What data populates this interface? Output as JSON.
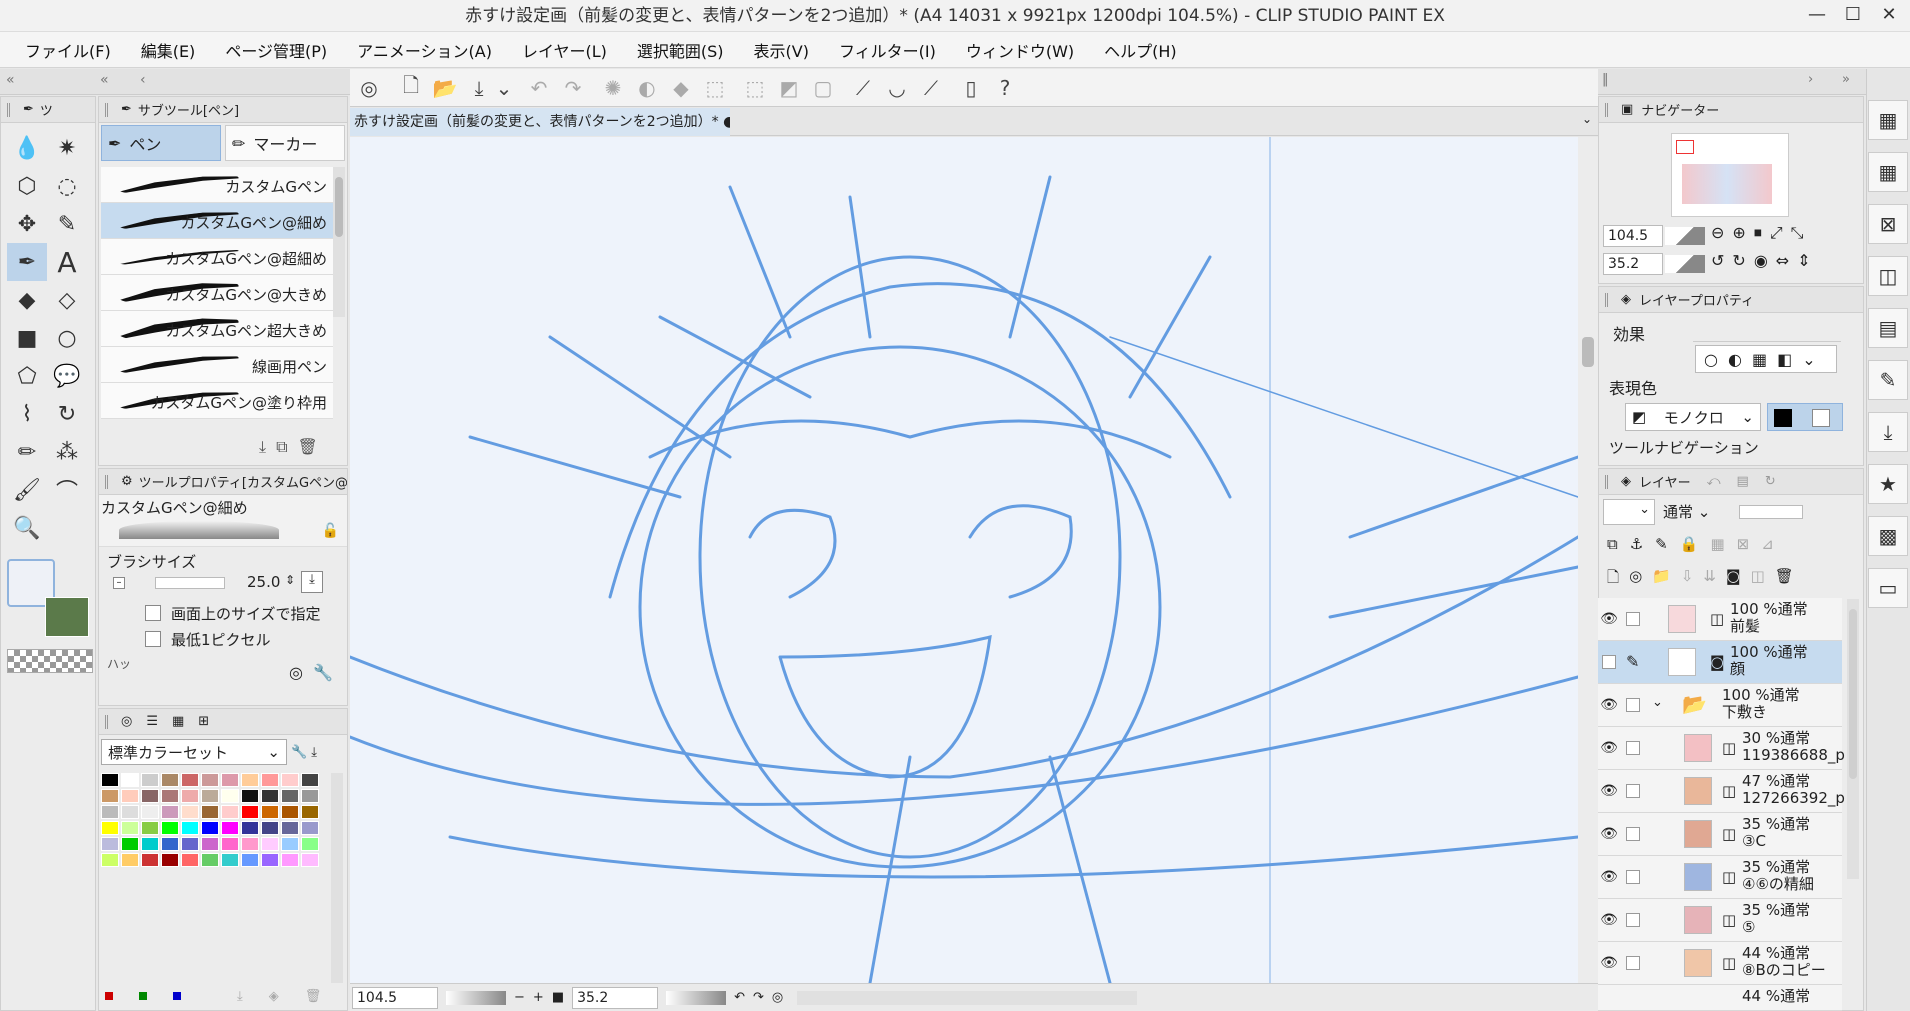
{
  "window": {
    "title": "赤すけ設定画（前髪の変更と、表情パターンを2つ追加）* (A4 14031 x 9921px 1200dpi 104.5%) - CLIP STUDIO PAINT EX",
    "controls": [
      "—",
      "☐",
      "✕"
    ]
  },
  "menu": [
    "ファイル(F)",
    "編集(E)",
    "ページ管理(P)",
    "アニメーション(A)",
    "レイヤー(L)",
    "選択範囲(S)",
    "表示(V)",
    "フィルター(I)",
    "ウィンドウ(W)",
    "ヘルプ(H)"
  ],
  "tool_palette": {
    "header": "ツ",
    "tools": [
      "blend-icon",
      "magic-wand-icon",
      "object-select-icon",
      "lasso-icon",
      "move-icon",
      "pen-tool-icon",
      "pen-icon",
      "text-icon",
      "fill-icon",
      "eraser-icon",
      "gradient-icon",
      "shape-icon",
      "figure-icon",
      "balloon-icon",
      "eyedropper-icon",
      "rotate-icon",
      "marker-icon",
      "airbrush-icon",
      "brush-icon",
      "decoration-icon",
      "zoom-icon"
    ],
    "main_color": "#eef1f7",
    "sub_color": "#5b7a4a"
  },
  "subtool": {
    "header": "サブツール[ペン]",
    "tab_pen": "ペン",
    "tab_marker": "マーカー",
    "brushes": [
      "カスタムGペン",
      "カスタムGペン@細め",
      "カスタムGペン@超細め",
      "カスタムGペン@大きめ",
      "カスタムGペン超大きめ",
      "線画用ペン",
      "カスタムGペン@塗り枠用"
    ],
    "selected": 1
  },
  "tool_property": {
    "header": "ツールプロパティ[カスタムGペン@",
    "brush_name": "カスタムGペン@細め",
    "size_label": "ブラシサイズ",
    "size_value": "25.0",
    "opt1": "画面上のサイズで指定",
    "opt2": "最低1ピクセル",
    "cut": "ハッ"
  },
  "color_set": {
    "name": "標準カラーセット"
  },
  "canvas_tab": {
    "label": "赤すけ設定画（前髪の変更と、表情パターンを2つ追加）*"
  },
  "status": {
    "zoom": "104.5",
    "angle": "35.2"
  },
  "navigator": {
    "header": "ナビゲーター",
    "zoom": "104.5",
    "angle": "35.2"
  },
  "layer_property": {
    "header": "レイヤープロパティ",
    "effect_label": "効果",
    "color_label": "表現色",
    "color_mode": "モノクロ",
    "tool_nav": "ツールナビゲーション"
  },
  "layers": {
    "header": "レイヤー",
    "blend": "通常",
    "rows": [
      {
        "l1": "100 %通常",
        "l2": "前髪",
        "sel": false
      },
      {
        "l1": "100 %通常",
        "l2": "顔",
        "sel": true
      },
      {
        "l1": "100 %通常",
        "l2": "下敷き",
        "sel": false
      },
      {
        "l1": "30 %通常",
        "l2": "119386688_p",
        "sel": false
      },
      {
        "l1": "47 %通常",
        "l2": "127266392_p",
        "sel": false
      },
      {
        "l1": "35 %通常",
        "l2": "③C",
        "sel": false
      },
      {
        "l1": "35 %通常",
        "l2": "④⑥の精細",
        "sel": false
      },
      {
        "l1": "35 %通常",
        "l2": "⑤",
        "sel": false
      },
      {
        "l1": "44 %通常",
        "l2": "⑧Bのコピー",
        "sel": false
      },
      {
        "l1": "44 %通常",
        "l2": "",
        "sel": false
      }
    ]
  }
}
